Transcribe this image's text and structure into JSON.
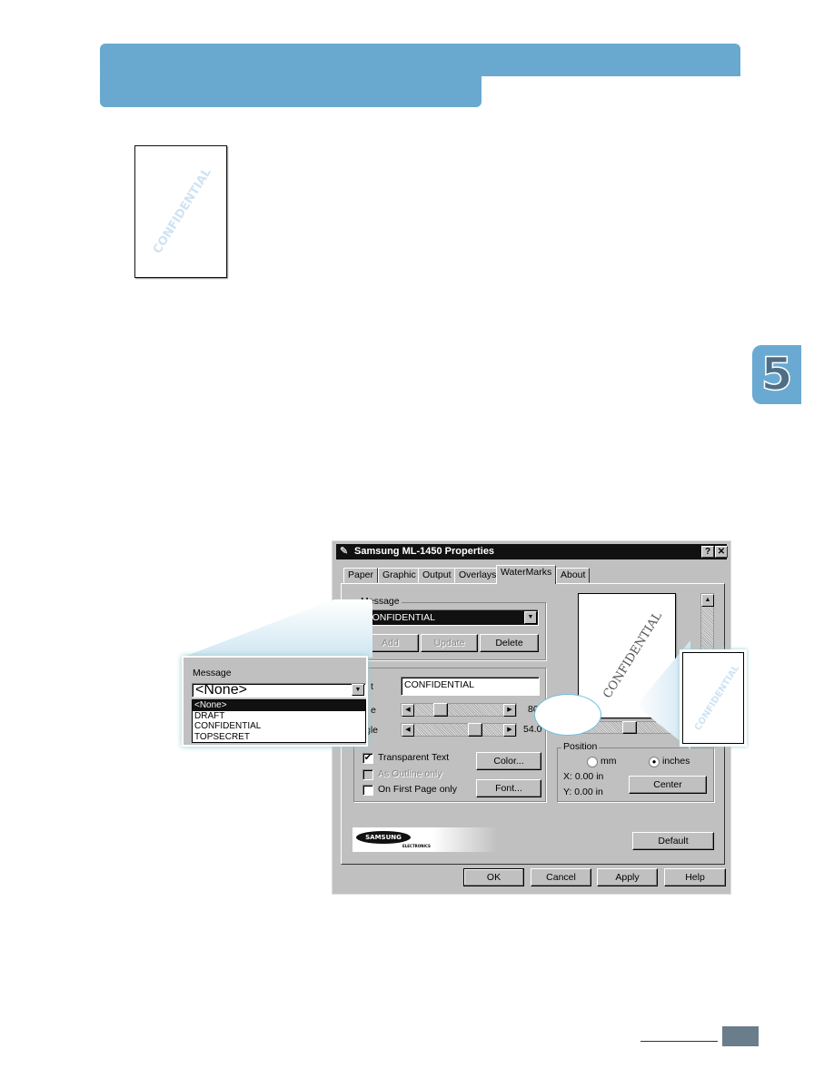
{
  "page": {
    "chapter_number": "5",
    "header_color": "#69a9cf"
  },
  "sample_page": {
    "watermark": "CONFIDENTIAL"
  },
  "dialog": {
    "title": "Samsung ML-1450 Properties",
    "help_btn": "?",
    "close_btn": "✕",
    "tabs": [
      "Paper",
      "Graphic",
      "Output",
      "Overlays",
      "WaterMarks",
      "About"
    ],
    "active_tab": "WaterMarks",
    "message": {
      "label": "Message",
      "selected": "CONFIDENTIAL",
      "add": "Add",
      "update": "Update",
      "delete": "Delete"
    },
    "text_group": {
      "label_fragment": "t",
      "text_label_fragment": "t",
      "text_value": "CONFIDENTIAL",
      "size_label_fragment": "e",
      "size_value": "80",
      "angle_label_fragment": "gle",
      "angle_value": "54.0",
      "size_level": 0.25,
      "angle_level": 0.7
    },
    "options": {
      "transparent": "Transparent Text",
      "transparent_checked": true,
      "outline": "As Outline only",
      "outline_checked": false,
      "first_page": "On First Page only",
      "first_page_checked": false,
      "color": "Color...",
      "font": "Font..."
    },
    "preview": {
      "watermark": "CONFIDENTIAL"
    },
    "position": {
      "label": "Position",
      "mm": "mm",
      "inches": "inches",
      "selected": "inches",
      "x": "X:  0.00 in",
      "y": "Y:  0.00 in",
      "center": "Center"
    },
    "logo": {
      "brand": "SAMSUNG",
      "sub": "ELECTRONICS"
    },
    "default": "Default",
    "buttons": {
      "ok": "OK",
      "cancel": "Cancel",
      "apply": "Apply",
      "help": "Help"
    }
  },
  "zoom_callout": {
    "label": "Message",
    "selected": "<None>",
    "options": [
      "<None>",
      "DRAFT",
      "CONFIDENTIAL",
      "TOPSECRET"
    ],
    "highlighted": "<None>"
  },
  "preview_callout": {
    "watermark": "CONFIDENTIAL"
  }
}
